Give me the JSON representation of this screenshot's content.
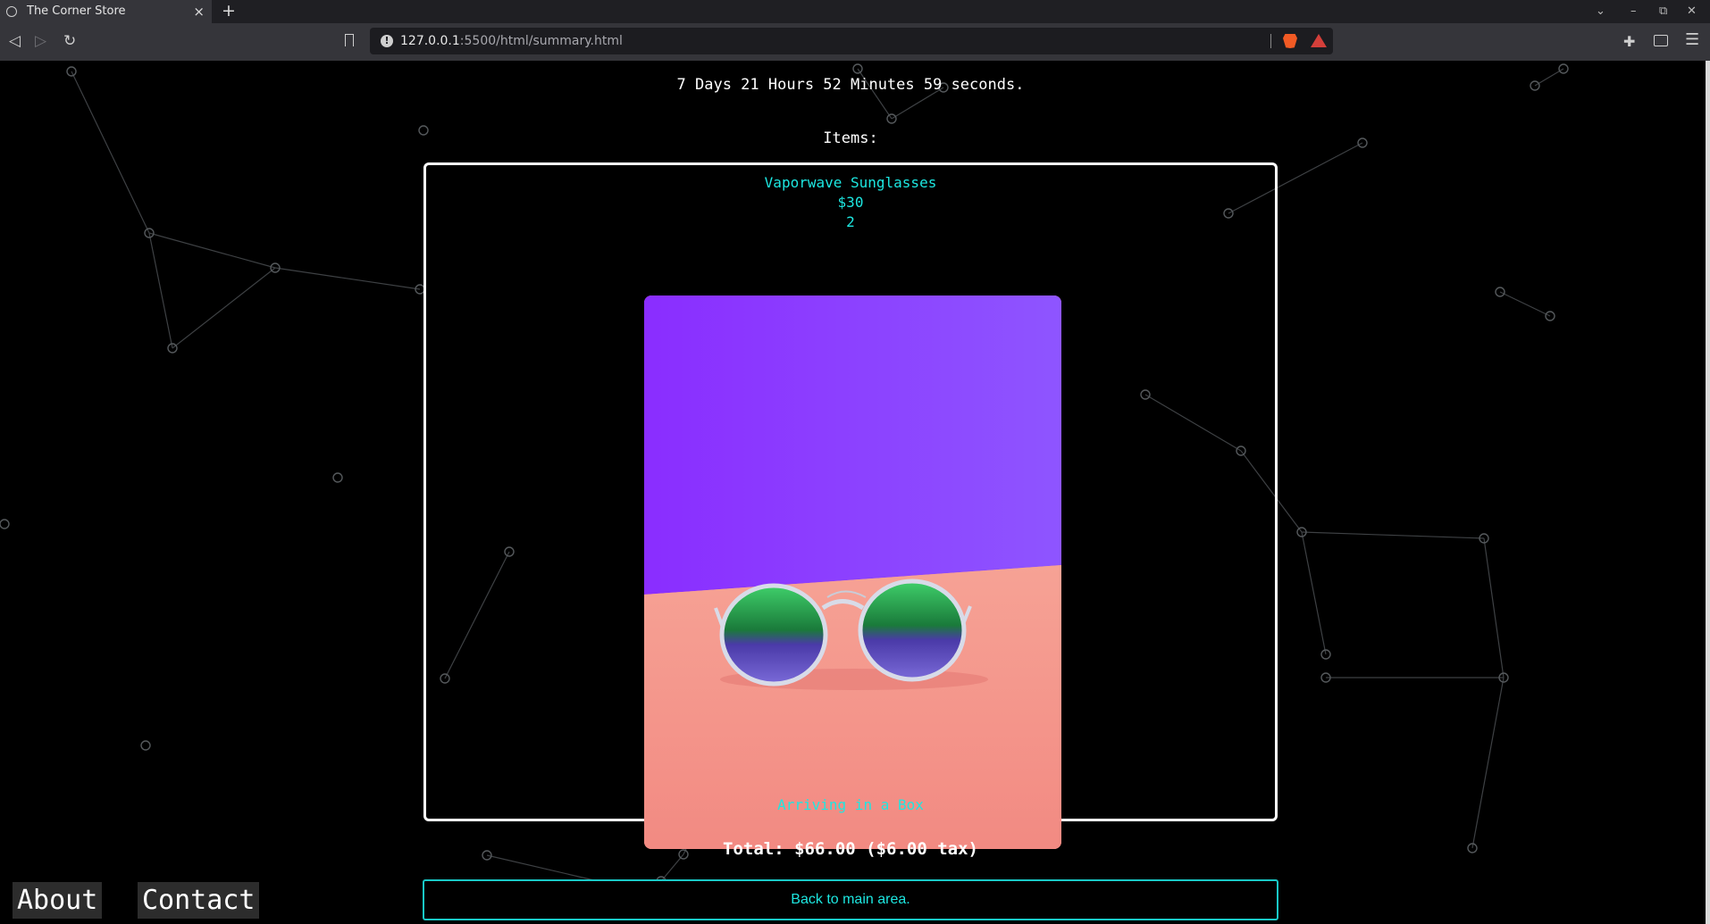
{
  "browser": {
    "tab_title": "The Corner Store",
    "tab_close": "×",
    "new_tab": "+",
    "url_host": "127.0.0.1",
    "url_path": ":5500/html/summary.html",
    "back": "◁",
    "forward": "▷",
    "reload": "↻",
    "win_down": "⌄",
    "win_min": "–",
    "win_max": "⧉",
    "win_close": "✕",
    "extensions": "✚",
    "menu": "☰"
  },
  "page": {
    "countdown": "7 Days 21 Hours 52 Minutes 59 seconds.",
    "items_label": "Items:",
    "item": {
      "name": "Vaporwave Sunglasses",
      "price": "$30",
      "quantity": "2",
      "shipping": "Arriving in a Box"
    },
    "total": "Total: $66.00 ($6.00 tax)",
    "back_button": "Back to main area.",
    "nav": {
      "about": "About",
      "contact": "Contact"
    }
  },
  "colors": {
    "accent": "#1de7e1",
    "background": "#000000",
    "image_top": "#8b3cff",
    "image_bottom": "#f39187"
  }
}
